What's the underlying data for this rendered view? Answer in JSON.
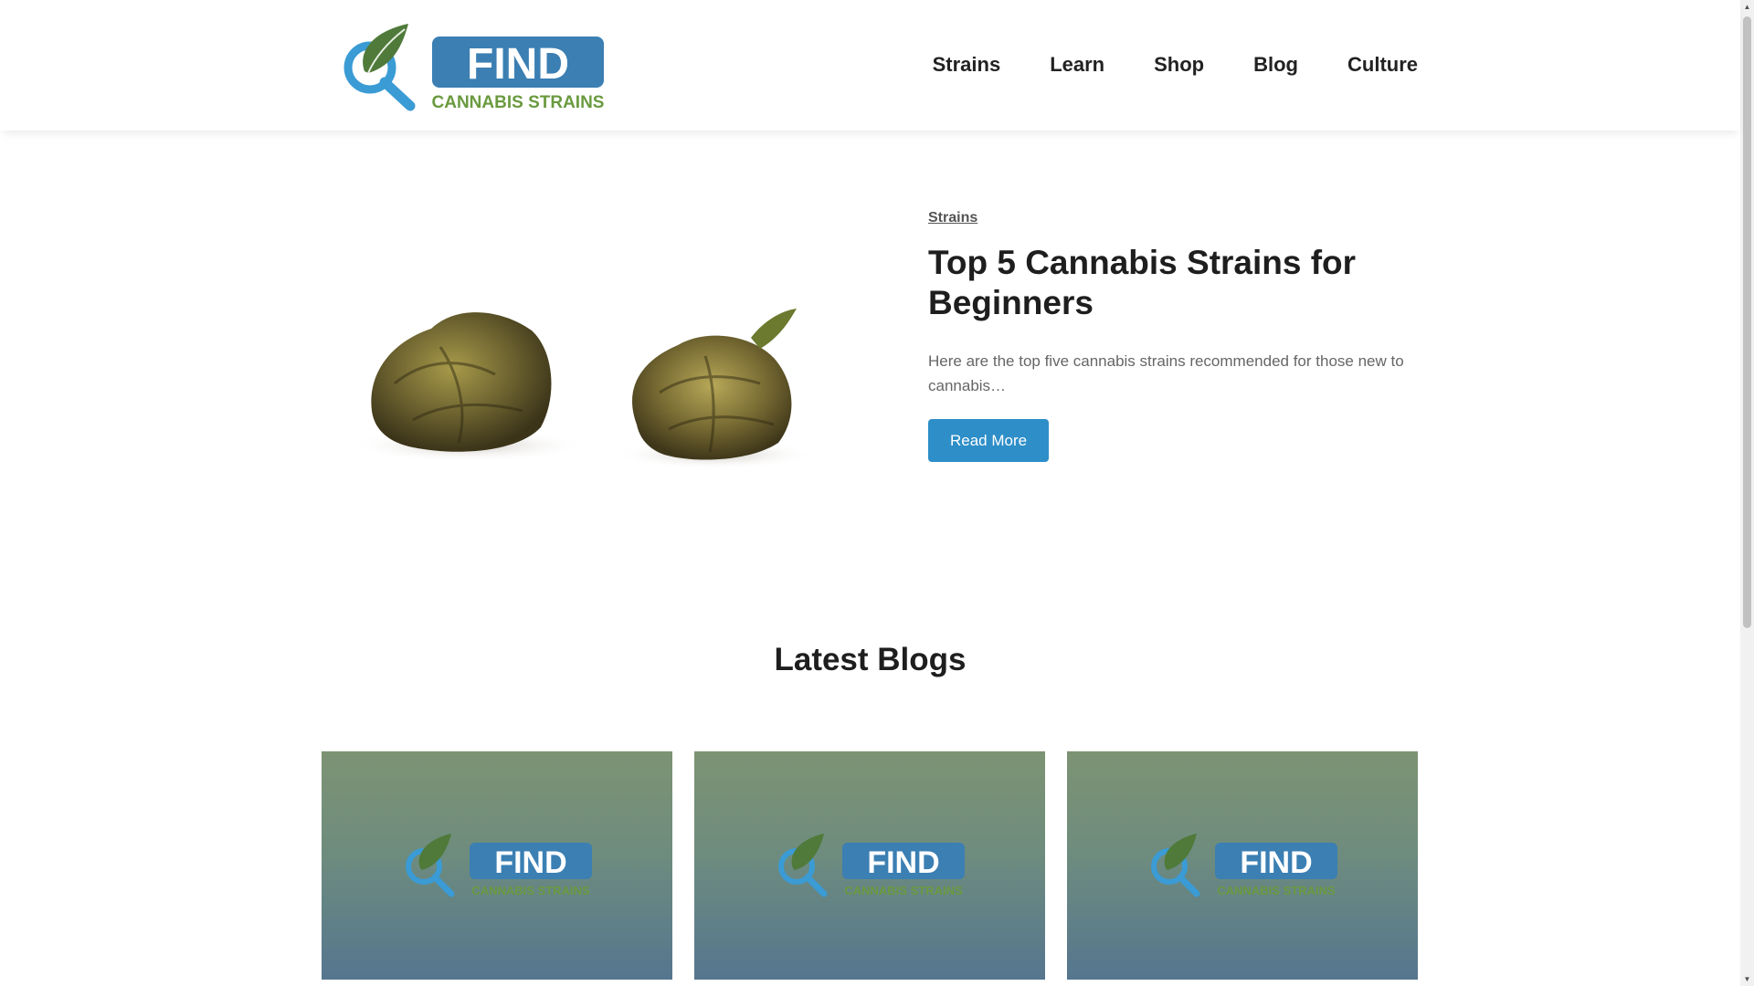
{
  "header": {
    "logo_text": "FIND",
    "logo_subtext": "CANNABIS STRAINS",
    "nav": [
      {
        "label": "Strains"
      },
      {
        "label": "Learn"
      },
      {
        "label": "Shop"
      },
      {
        "label": "Blog"
      },
      {
        "label": "Culture"
      }
    ]
  },
  "hero": {
    "category": "Strains",
    "title": "Top 5 Cannabis Strains for Beginners",
    "excerpt": "Here are the top five cannabis strains recommended for those new to cannabis…",
    "button_label": "Read More"
  },
  "latest": {
    "title": "Latest Blogs",
    "cards": [
      {
        "logo_text": "FIND",
        "logo_subtext": "CANNABIS STRAINS"
      },
      {
        "logo_text": "FIND",
        "logo_subtext": "CANNABIS STRAINS"
      },
      {
        "logo_text": "FIND",
        "logo_subtext": "CANNABIS STRAINS"
      }
    ]
  },
  "colors": {
    "accent": "#2d8ec8",
    "logo_blue": "#3b7fb3",
    "logo_green": "#4f7a3a"
  }
}
